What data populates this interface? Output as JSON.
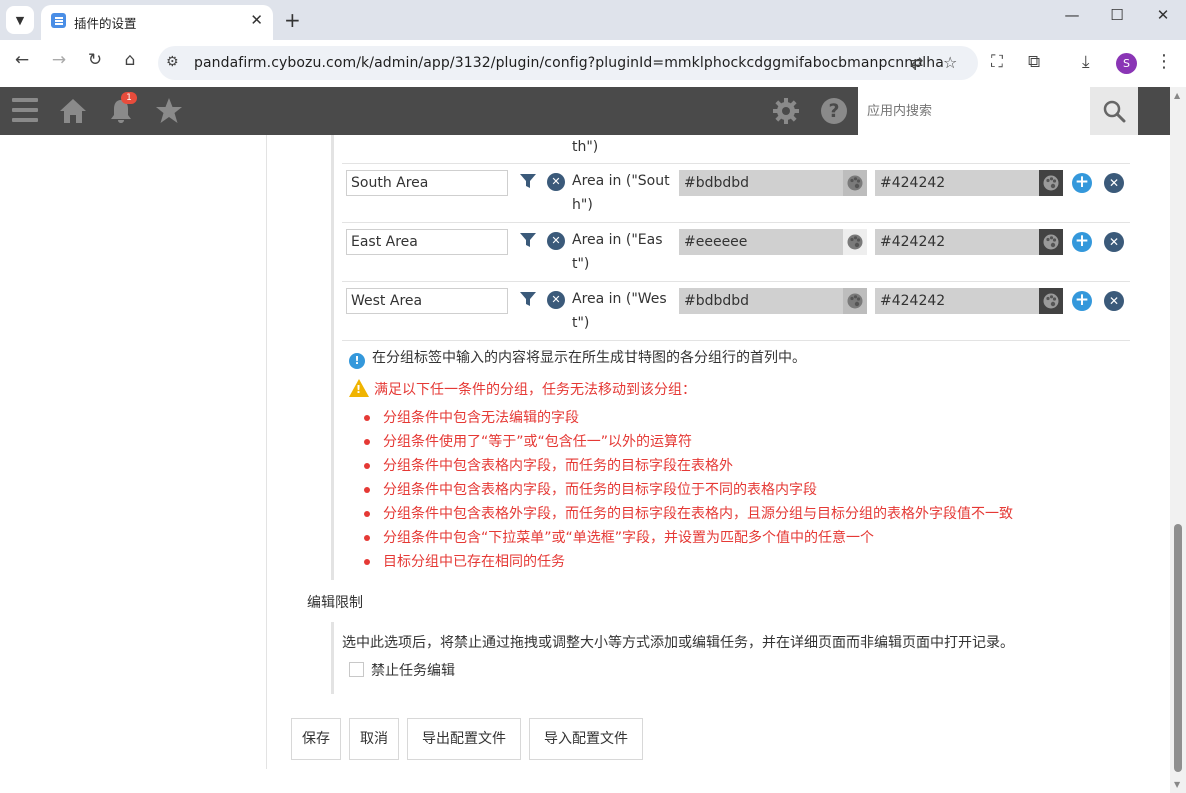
{
  "browser": {
    "tab_title": "插件的设置",
    "url": "pandafirm.cybozu.com/k/admin/app/3132/plugin/config?pluginId=mmklphockcdggmifabocbmanpcnnplha",
    "profile_initial": "S"
  },
  "appbar": {
    "notification_count": "1",
    "search_placeholder": "应用内搜索"
  },
  "groups": {
    "partial_row_condition": "th\")",
    "rows": [
      {
        "name": "South Area",
        "condition": "Area in (\"South\")",
        "color1": "#bdbdbd",
        "color2": "#424242"
      },
      {
        "name": "East Area",
        "condition": "Area in (\"East\")",
        "color1": "#eeeeee",
        "color2": "#424242"
      },
      {
        "name": "West Area",
        "condition": "Area in (\"West\")",
        "color1": "#bdbdbd",
        "color2": "#424242"
      }
    ]
  },
  "info_text": "在分组标签中输入的内容将显示在所生成甘特图的各分组行的首列中。",
  "warning": {
    "title": "满足以下任一条件的分组，任务无法移动到该分组：",
    "items": [
      "分组条件中包含无法编辑的字段",
      "分组条件使用了“等于”或“包含任一”以外的运算符",
      "分组条件中包含表格内字段，而任务的目标字段在表格外",
      "分组条件中包含表格内字段，而任务的目标字段位于不同的表格内字段",
      "分组条件中包含表格外字段，而任务的目标字段在表格内，且源分组与目标分组的表格外字段值不一致",
      "分组条件中包含“下拉菜单”或“单选框”字段，并设置为匹配多个值中的任意一个",
      "目标分组中已存在相同的任务"
    ]
  },
  "edit_restriction": {
    "title": "编辑限制",
    "description": "选中此选项后，将禁止通过拖拽或调整大小等方式添加或编辑任务，并在详细页面而非编辑页面中打开记录。",
    "checkbox_label": "禁止任务编辑",
    "checked": false
  },
  "buttons": {
    "save": "保存",
    "cancel": "取消",
    "export": "导出配置文件",
    "import": "导入配置文件"
  }
}
